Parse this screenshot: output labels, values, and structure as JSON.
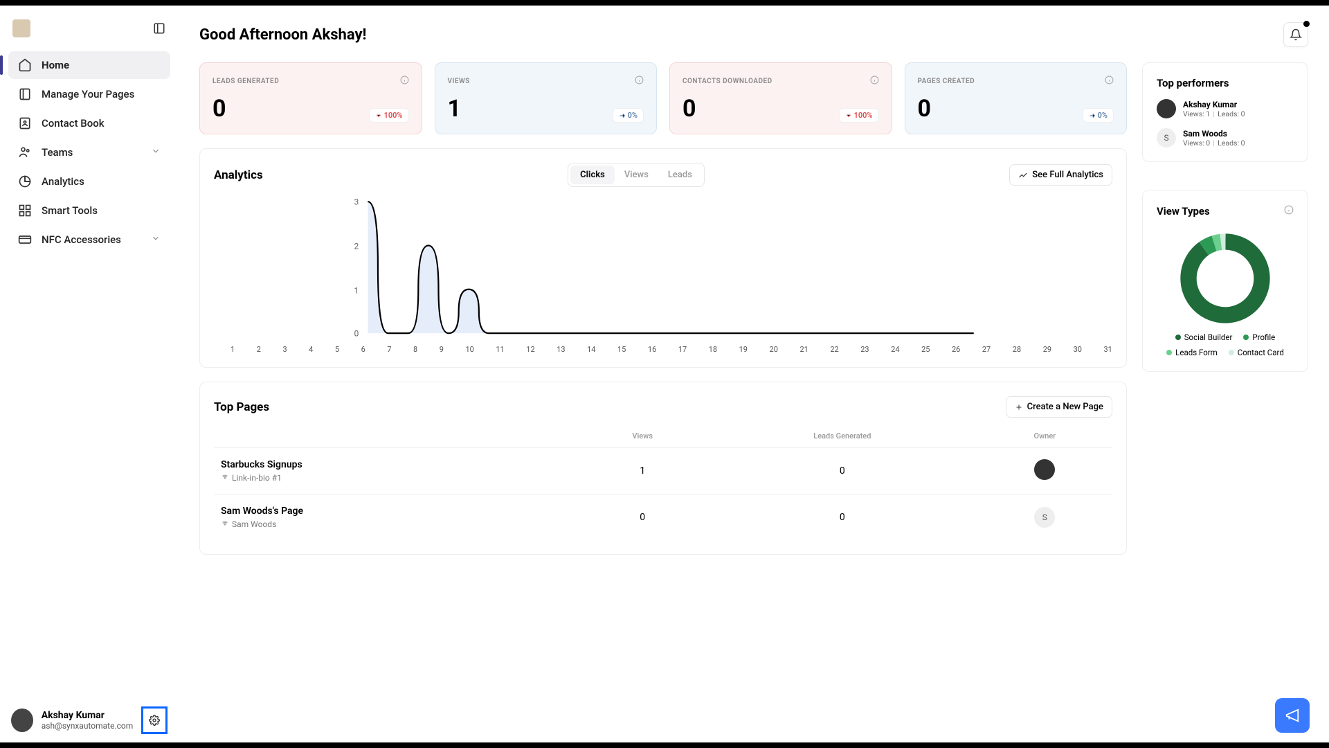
{
  "greeting": "Good Afternoon Akshay!",
  "sidebar": {
    "items": [
      {
        "label": "Home",
        "active": true,
        "chev": false
      },
      {
        "label": "Manage Your Pages",
        "active": false,
        "chev": false
      },
      {
        "label": "Contact Book",
        "active": false,
        "chev": false
      },
      {
        "label": "Teams",
        "active": false,
        "chev": true
      },
      {
        "label": "Analytics",
        "active": false,
        "chev": false
      },
      {
        "label": "Smart Tools",
        "active": false,
        "chev": false
      },
      {
        "label": "NFC Accessories",
        "active": false,
        "chev": true
      }
    ]
  },
  "user": {
    "name": "Akshay Kumar",
    "email": "ash@synxautomate.com"
  },
  "stats": [
    {
      "title": "LEADS GENERATED",
      "value": "0",
      "delta": "100%",
      "dir": "down",
      "tone": "pink"
    },
    {
      "title": "VIEWS",
      "value": "1",
      "delta": "0%",
      "dir": "flat",
      "tone": "blue"
    },
    {
      "title": "CONTACTS DOWNLOADED",
      "value": "0",
      "delta": "100%",
      "dir": "down",
      "tone": "pink"
    },
    {
      "title": "PAGES CREATED",
      "value": "0",
      "delta": "0%",
      "dir": "flat",
      "tone": "blue"
    }
  ],
  "analytics": {
    "title": "Analytics",
    "tabs": [
      "Clicks",
      "Views",
      "Leads"
    ],
    "active_tab": "Clicks",
    "full_btn": "See Full Analytics",
    "y_ticks": [
      "3",
      "2",
      "1",
      "0"
    ]
  },
  "chart_data": {
    "type": "area",
    "categories": [
      "1",
      "2",
      "3",
      "4",
      "5",
      "6",
      "7",
      "8",
      "9",
      "10",
      "11",
      "12",
      "13",
      "14",
      "15",
      "16",
      "17",
      "18",
      "19",
      "20",
      "21",
      "22",
      "23",
      "24",
      "25",
      "26",
      "27",
      "28",
      "29",
      "30",
      "31"
    ],
    "values": [
      3,
      0,
      0,
      2,
      0,
      1,
      0,
      0,
      0,
      0,
      0,
      0,
      0,
      0,
      0,
      0,
      0,
      0,
      0,
      0,
      0,
      0,
      0,
      0,
      0,
      0,
      0,
      0,
      0,
      0,
      0
    ],
    "ylim": [
      0,
      3
    ]
  },
  "top_performers": {
    "title": "Top performers",
    "items": [
      {
        "name": "Akshay Kumar",
        "views": "Views: 1",
        "leads": "Leads: 0",
        "avatar": "img"
      },
      {
        "name": "Sam Woods",
        "views": "Views: 0",
        "leads": "Leads: 0",
        "avatar": "S"
      }
    ]
  },
  "view_types": {
    "title": "View Types",
    "legend": [
      {
        "label": "Social Builder",
        "color": "#1f6b3a"
      },
      {
        "label": "Profile",
        "color": "#2c9a55"
      },
      {
        "label": "Leads Form",
        "color": "#6dcf8e"
      },
      {
        "label": "Contact Card",
        "color": "#cfeedd"
      }
    ],
    "segments": [
      {
        "color": "#1f6b3a",
        "frac": 0.9
      },
      {
        "color": "#2c9a55",
        "frac": 0.05
      },
      {
        "color": "#6dcf8e",
        "frac": 0.03
      },
      {
        "color": "#cfeedd",
        "frac": 0.02
      }
    ]
  },
  "top_pages": {
    "title": "Top Pages",
    "create_btn": "Create a New Page",
    "columns": [
      "",
      "Views",
      "Leads Generated",
      "Owner"
    ],
    "rows": [
      {
        "name": "Starbucks Signups",
        "sub": "Link-in-bio #1",
        "views": "1",
        "leads": "0",
        "owner": "img"
      },
      {
        "name": "Sam Woods's Page",
        "sub": "Sam Woods",
        "views": "0",
        "leads": "0",
        "owner": "S"
      }
    ]
  }
}
